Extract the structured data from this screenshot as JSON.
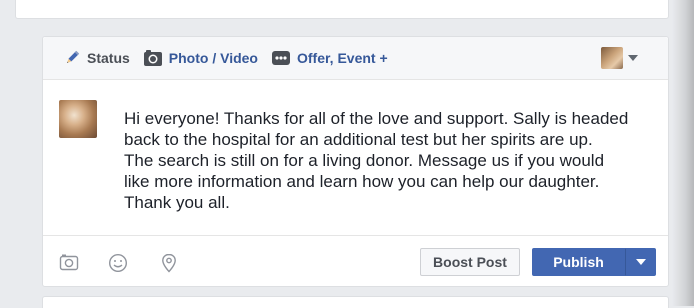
{
  "composer": {
    "tabs": [
      {
        "label": "Status",
        "icon": "pencil-icon"
      },
      {
        "label": "Photo / Video",
        "icon": "camera-icon"
      },
      {
        "label": "Offer, Event +",
        "icon": "more-icon"
      }
    ],
    "post_text": "Hi everyone! Thanks for all of the love and support. Sally is headed\nback to the hospital for an additional test but her spirits are up.\nThe search is still on for a living donor. Message us if you would\nlike more information and learn how you can help our daughter.\nThank you all.",
    "footer": {
      "icons": [
        "camera-icon",
        "smiley-icon",
        "location-pin-icon"
      ],
      "boost_label": "Boost Post",
      "publish_label": "Publish"
    }
  },
  "colors": {
    "accent": "#4267b2",
    "link": "#365899",
    "page_bg": "#e9ebee"
  }
}
